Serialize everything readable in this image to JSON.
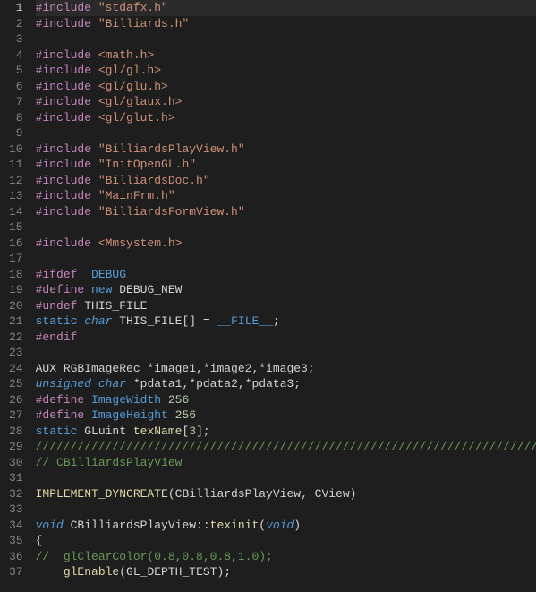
{
  "editor": {
    "active_line": 1,
    "lines": [
      {
        "n": 1,
        "tokens": [
          {
            "t": "#include ",
            "c": "pp"
          },
          {
            "t": "\"stdafx.h\"",
            "c": "str"
          }
        ]
      },
      {
        "n": 2,
        "tokens": [
          {
            "t": "#include ",
            "c": "pp"
          },
          {
            "t": "\"Billiards.h\"",
            "c": "str"
          }
        ]
      },
      {
        "n": 3,
        "tokens": [
          {
            "t": "",
            "c": "id"
          }
        ]
      },
      {
        "n": 4,
        "tokens": [
          {
            "t": "#include ",
            "c": "pp"
          },
          {
            "t": "<math.h>",
            "c": "str"
          }
        ]
      },
      {
        "n": 5,
        "tokens": [
          {
            "t": "#include ",
            "c": "pp"
          },
          {
            "t": "<gl/gl.h>",
            "c": "str"
          }
        ]
      },
      {
        "n": 6,
        "tokens": [
          {
            "t": "#include ",
            "c": "pp"
          },
          {
            "t": "<gl/glu.h>",
            "c": "str"
          }
        ]
      },
      {
        "n": 7,
        "tokens": [
          {
            "t": "#include ",
            "c": "pp"
          },
          {
            "t": "<gl/glaux.h>",
            "c": "str"
          }
        ]
      },
      {
        "n": 8,
        "tokens": [
          {
            "t": "#include ",
            "c": "pp"
          },
          {
            "t": "<gl/glut.h>",
            "c": "str"
          }
        ]
      },
      {
        "n": 9,
        "tokens": [
          {
            "t": "",
            "c": "id"
          }
        ]
      },
      {
        "n": 10,
        "tokens": [
          {
            "t": "#include ",
            "c": "pp"
          },
          {
            "t": "\"BilliardsPlayView.h\"",
            "c": "str"
          }
        ]
      },
      {
        "n": 11,
        "tokens": [
          {
            "t": "#include ",
            "c": "pp"
          },
          {
            "t": "\"InitOpenGL.h\"",
            "c": "str"
          }
        ]
      },
      {
        "n": 12,
        "tokens": [
          {
            "t": "#include ",
            "c": "pp"
          },
          {
            "t": "\"BilliardsDoc.h\"",
            "c": "str"
          }
        ]
      },
      {
        "n": 13,
        "tokens": [
          {
            "t": "#include ",
            "c": "pp"
          },
          {
            "t": "\"MainFrm.h\"",
            "c": "str"
          }
        ]
      },
      {
        "n": 14,
        "tokens": [
          {
            "t": "#include ",
            "c": "pp"
          },
          {
            "t": "\"BilliardsFormView.h\"",
            "c": "str"
          }
        ]
      },
      {
        "n": 15,
        "tokens": [
          {
            "t": "",
            "c": "id"
          }
        ]
      },
      {
        "n": 16,
        "tokens": [
          {
            "t": "#include ",
            "c": "pp"
          },
          {
            "t": "<Mmsystem.h>",
            "c": "str"
          }
        ]
      },
      {
        "n": 17,
        "tokens": [
          {
            "t": "",
            "c": "id"
          }
        ]
      },
      {
        "n": 18,
        "tokens": [
          {
            "t": "#ifdef ",
            "c": "pp"
          },
          {
            "t": "_DEBUG",
            "c": "mac"
          }
        ]
      },
      {
        "n": 19,
        "tokens": [
          {
            "t": "#define ",
            "c": "pp"
          },
          {
            "t": "new",
            "c": "kw"
          },
          {
            "t": " DEBUG_NEW",
            "c": "id"
          }
        ]
      },
      {
        "n": 20,
        "tokens": [
          {
            "t": "#undef ",
            "c": "pp"
          },
          {
            "t": "THIS_FILE",
            "c": "id"
          }
        ]
      },
      {
        "n": 21,
        "tokens": [
          {
            "t": "static",
            "c": "kw"
          },
          {
            "t": " ",
            "c": "id"
          },
          {
            "t": "char",
            "c": "ty"
          },
          {
            "t": " THIS_FILE[] = ",
            "c": "id"
          },
          {
            "t": "__FILE__",
            "c": "mac"
          },
          {
            "t": ";",
            "c": "id"
          }
        ]
      },
      {
        "n": 22,
        "tokens": [
          {
            "t": "#endif",
            "c": "pp"
          }
        ]
      },
      {
        "n": 23,
        "tokens": [
          {
            "t": "",
            "c": "id"
          }
        ]
      },
      {
        "n": 24,
        "tokens": [
          {
            "t": "AUX_RGBImageRec *image1,*image2,*image3;",
            "c": "id"
          }
        ]
      },
      {
        "n": 25,
        "tokens": [
          {
            "t": "unsigned",
            "c": "ty"
          },
          {
            "t": " ",
            "c": "id"
          },
          {
            "t": "char",
            "c": "ty"
          },
          {
            "t": " *pdata1,*pdata2,*pdata3;",
            "c": "id"
          }
        ]
      },
      {
        "n": 26,
        "tokens": [
          {
            "t": "#define ",
            "c": "pp"
          },
          {
            "t": "ImageWidth",
            "c": "mac"
          },
          {
            "t": " ",
            "c": "id"
          },
          {
            "t": "256",
            "c": "num"
          }
        ]
      },
      {
        "n": 27,
        "tokens": [
          {
            "t": "#define ",
            "c": "pp"
          },
          {
            "t": "ImageHeight",
            "c": "mac"
          },
          {
            "t": " ",
            "c": "id"
          },
          {
            "t": "256",
            "c": "num"
          }
        ]
      },
      {
        "n": 28,
        "tokens": [
          {
            "t": "static",
            "c": "kw"
          },
          {
            "t": " GLuint ",
            "c": "id"
          },
          {
            "t": "texName",
            "c": "fn"
          },
          {
            "t": "[",
            "c": "id"
          },
          {
            "t": "3",
            "c": "num"
          },
          {
            "t": "];",
            "c": "id"
          }
        ]
      },
      {
        "n": 29,
        "tokens": [
          {
            "t": "/////////////////////////////////////////////////////////////////////////////",
            "c": "cmt"
          }
        ]
      },
      {
        "n": 30,
        "tokens": [
          {
            "t": "// CBilliardsPlayView",
            "c": "cmt"
          }
        ]
      },
      {
        "n": 31,
        "tokens": [
          {
            "t": "",
            "c": "id"
          }
        ]
      },
      {
        "n": 32,
        "tokens": [
          {
            "t": "IMPLEMENT_DYNCREATE",
            "c": "fn"
          },
          {
            "t": "(CBilliardsPlayView, CView)",
            "c": "id"
          }
        ]
      },
      {
        "n": 33,
        "tokens": [
          {
            "t": "",
            "c": "id"
          }
        ]
      },
      {
        "n": 34,
        "tokens": [
          {
            "t": "void",
            "c": "ty"
          },
          {
            "t": " CBilliardsPlayView::",
            "c": "id"
          },
          {
            "t": "texinit",
            "c": "fn"
          },
          {
            "t": "(",
            "c": "id"
          },
          {
            "t": "void",
            "c": "ty"
          },
          {
            "t": ")",
            "c": "id"
          }
        ]
      },
      {
        "n": 35,
        "tokens": [
          {
            "t": "{",
            "c": "id"
          }
        ]
      },
      {
        "n": 36,
        "tokens": [
          {
            "t": "//  glClearColor(0.8,0.8,0.8,1.0);",
            "c": "cmt"
          }
        ]
      },
      {
        "n": 37,
        "tokens": [
          {
            "t": "    ",
            "c": "id"
          },
          {
            "t": "glEnable",
            "c": "fn"
          },
          {
            "t": "(GL_DEPTH_TEST);",
            "c": "id"
          }
        ]
      }
    ]
  }
}
